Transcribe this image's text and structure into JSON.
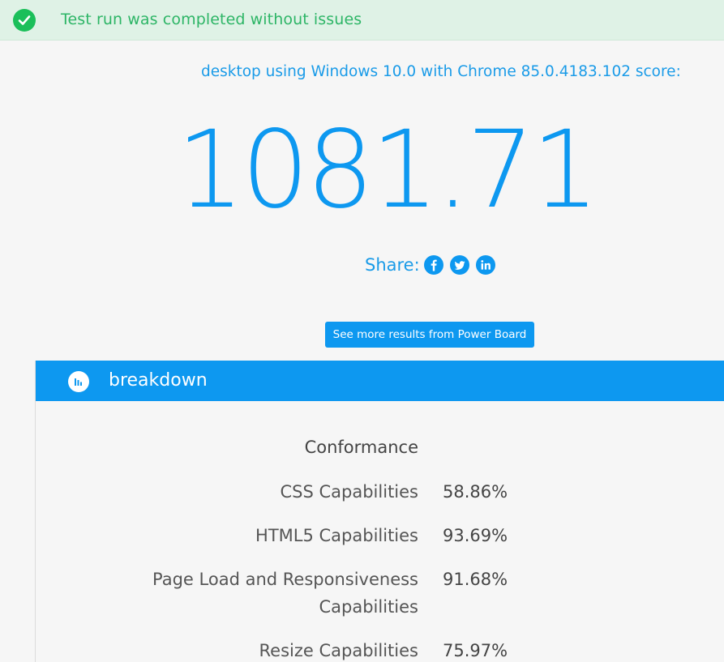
{
  "banner": {
    "status_icon": "check-circle-icon",
    "message": "Test run was completed without issues",
    "color": "#1bbf5a"
  },
  "score": {
    "caption": "desktop using Windows 10.0 with Chrome 85.0.4183.102 score:",
    "value": "1081.71"
  },
  "share": {
    "label": "Share:",
    "networks": [
      "facebook-icon",
      "twitter-icon",
      "linkedin-icon"
    ]
  },
  "more_results_button": "See more results from Power Board",
  "breakdown": {
    "icon": "bar-chart-icon",
    "title": "breakdown",
    "section": "Conformance",
    "rows": [
      {
        "label": "CSS Capabilities",
        "value": "58.86%"
      },
      {
        "label": "HTML5 Capabilities",
        "value": "93.69%"
      },
      {
        "label": "Page Load and Responsiveness Capabilities",
        "value": "91.68%"
      },
      {
        "label": "Resize Capabilities",
        "value": "75.97%"
      }
    ]
  },
  "colors": {
    "accent": "#0d98f0",
    "success_bg": "#dff2e6",
    "success_text": "#2db566"
  }
}
